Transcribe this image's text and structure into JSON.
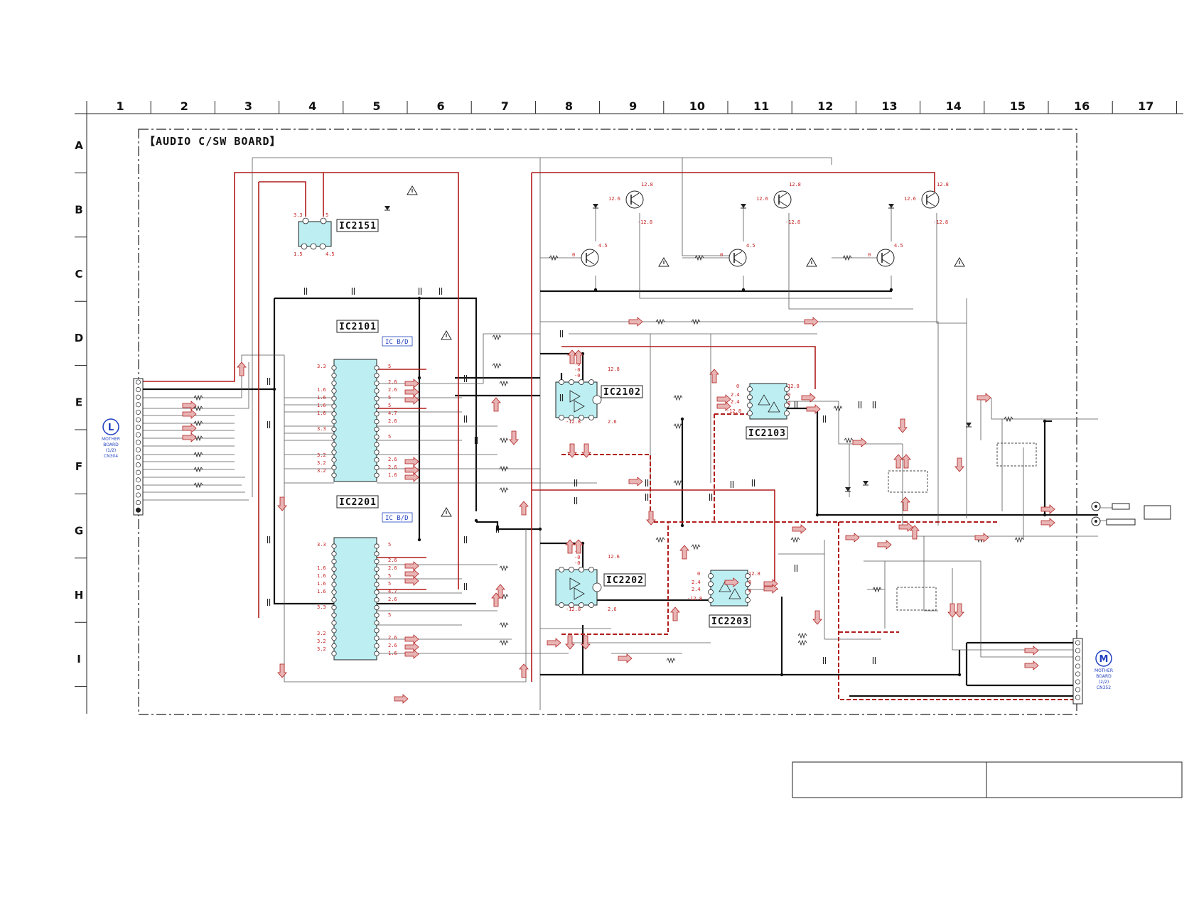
{
  "grid": {
    "columns": [
      "1",
      "2",
      "3",
      "4",
      "5",
      "6",
      "7",
      "8",
      "9",
      "10",
      "11",
      "12",
      "13",
      "14",
      "15",
      "16",
      "17"
    ],
    "rows": [
      "A",
      "B",
      "C",
      "D",
      "E",
      "F",
      "G",
      "H",
      "I"
    ]
  },
  "board_title": "【AUDIO C/SW BOARD】",
  "ic_labels": {
    "ic2151": "IC2151",
    "ic2101": "IC2101",
    "ic2201": "IC2201",
    "ic2102": "IC2102",
    "ic2103": "IC2103",
    "ic2202": "IC2202",
    "ic2203": "IC2203"
  },
  "ic_bd_tags": [
    "IC B/D",
    "IC B/D"
  ],
  "connectors": {
    "left": {
      "letter": "L",
      "caption": [
        "MOTHER",
        "BOARD",
        "(1/2)",
        "CN304"
      ]
    },
    "right": {
      "letter": "M",
      "caption": [
        "MOTHER",
        "BOARD",
        "(2/2)",
        "CN352"
      ]
    }
  },
  "voltages": {
    "ic2151_top": [
      "3.3",
      "5"
    ],
    "ic2151_bottom": [
      "1.5",
      "4.5"
    ],
    "ic2101_left": [
      "3.3",
      "1.6",
      "1.6",
      "1.6",
      "1.6",
      "3.3",
      "3.2",
      "3.2",
      "3.2"
    ],
    "ic2101_right": [
      "5",
      "2.6",
      "2.6",
      "5",
      "5",
      "4.7",
      "2.6",
      "5",
      "2.6",
      "2.6",
      "1.6"
    ],
    "ic2201_left": [
      "3.3",
      "1.6",
      "1.6",
      "1.6",
      "1.6",
      "3.3",
      "3.2",
      "3.2",
      "3.2"
    ],
    "ic2201_right": [
      "5",
      "2.6",
      "2.6",
      "5",
      "5",
      "4.7",
      "2.6",
      "5",
      "2.6",
      "2.6",
      "1.6"
    ],
    "transistors": [
      "12.8",
      "12.6",
      "-12.8",
      "0",
      "4.5"
    ],
    "ic2102": [
      "-0",
      "-0",
      "-0",
      "12.8",
      "-12.8",
      "2.6"
    ],
    "ic2103": [
      "0",
      "2.4",
      "2.4",
      "-12.8",
      "12.8",
      "0",
      "0"
    ],
    "ic2202": [
      "-0",
      "-0",
      "-0",
      "12.6",
      "-12.8",
      "2.6"
    ],
    "ic2203": [
      "0",
      "2.4",
      "2.4",
      "-12.8",
      "12.8",
      "0",
      "0"
    ]
  },
  "colors": {
    "wire": "#222222",
    "signal_red": "#b01c1c",
    "ic_fill": "#bdeef2",
    "label_blue": "#1f3fbf"
  }
}
